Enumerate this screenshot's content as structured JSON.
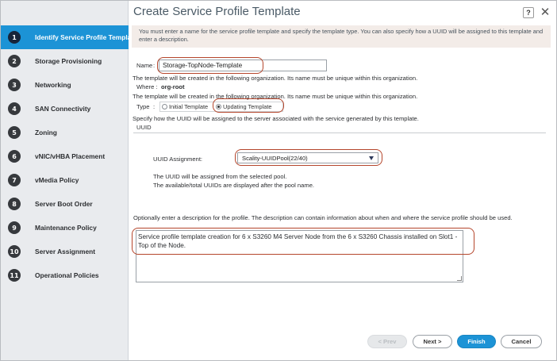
{
  "dialog": {
    "title": "Create Service Profile Template",
    "help_label": "?",
    "close_label": "✕"
  },
  "sidebar": {
    "items": [
      {
        "num": "1",
        "label": "Identify Service Profile Template",
        "active": true
      },
      {
        "num": "2",
        "label": "Storage Provisioning"
      },
      {
        "num": "3",
        "label": "Networking"
      },
      {
        "num": "4",
        "label": "SAN Connectivity"
      },
      {
        "num": "5",
        "label": "Zoning"
      },
      {
        "num": "6",
        "label": "vNIC/vHBA Placement"
      },
      {
        "num": "7",
        "label": "vMedia Policy"
      },
      {
        "num": "8",
        "label": "Server Boot Order"
      },
      {
        "num": "9",
        "label": "Maintenance Policy"
      },
      {
        "num": "10",
        "label": "Server Assignment"
      },
      {
        "num": "11",
        "label": "Operational Policies"
      }
    ]
  },
  "banner": {
    "text": "You must enter a name for the service profile template and specify the template type. You can also specify how a UUID will be assigned to this template and enter a description."
  },
  "form": {
    "name_label": "Name",
    "name_value": "Storage-TopNode-Template",
    "org_note": "The template will be created in the following organization. Its name must be unique within this organization.",
    "where_label": "Where :",
    "where_value": "org-root",
    "org_note_2": "The template will be created in the following organization. Its name must be unique within this organization.",
    "type_label": "Type",
    "type_options": [
      {
        "label": "Initial Template",
        "selected": false
      },
      {
        "label": "Updating Template",
        "selected": true
      }
    ],
    "uuid_note": "Specify how the UUID will be assigned to the server associated with the service generated by this template.",
    "uuid_heading": "UUID",
    "uuid_assignment_label": "UUID Assignment:",
    "uuid_assignment_value": "Scality-UUIDPool(22/40)",
    "uuid_pool_note_1": "The UUID will be assigned from the selected pool.",
    "uuid_pool_note_2": "The available/total UUIDs are displayed after the pool name.",
    "description_prompt": "Optionally enter a description for the profile. The description can contain information about when and where the service profile should be used.",
    "description_value": "Service profile template creation for 6 x S3260 M4 Server Node from the 6 x S3260 Chassis installed on Slot1 - Top of the Node."
  },
  "footer": {
    "prev_label": "< Prev",
    "next_label": "Next >",
    "finish_label": "Finish",
    "cancel_label": "Cancel"
  },
  "colors": {
    "accent": "#1c93d6",
    "highlight": "#b5462c"
  }
}
